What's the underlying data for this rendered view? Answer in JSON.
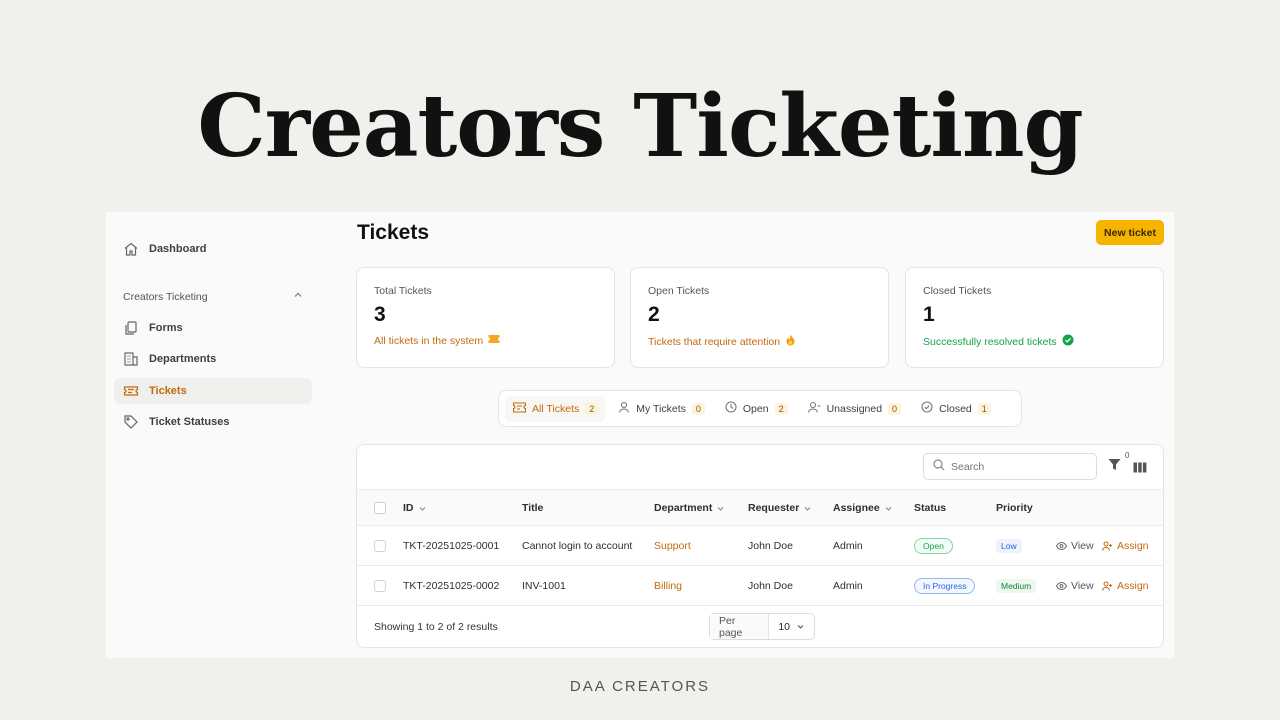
{
  "hero": {
    "title": "Creators Ticketing",
    "footer": "DAA CREATORS"
  },
  "sidebar": {
    "dashboard": "Dashboard",
    "group_label": "Creators Ticketing",
    "items": [
      {
        "label": "Forms",
        "icon": "forms-icon"
      },
      {
        "label": "Departments",
        "icon": "building-icon"
      },
      {
        "label": "Tickets",
        "icon": "ticket-icon",
        "active": true
      },
      {
        "label": "Ticket Statuses",
        "icon": "tag-icon"
      }
    ]
  },
  "header": {
    "title": "Tickets",
    "new_ticket": "New ticket"
  },
  "stats": [
    {
      "label": "Total Tickets",
      "value": "3",
      "desc": "All tickets in the system",
      "color": "#c26a12"
    },
    {
      "label": "Open Tickets",
      "value": "2",
      "desc": "Tickets that require attention",
      "color": "#c26a12"
    },
    {
      "label": "Closed Tickets",
      "value": "1",
      "desc": "Successfully resolved tickets",
      "color": "#16a34a"
    }
  ],
  "tabs": [
    {
      "label": "All Tickets",
      "count": "2",
      "active": true
    },
    {
      "label": "My Tickets",
      "count": "0"
    },
    {
      "label": "Open",
      "count": "2"
    },
    {
      "label": "Unassigned",
      "count": "0"
    },
    {
      "label": "Closed",
      "count": "1"
    }
  ],
  "table": {
    "search_placeholder": "Search",
    "filter_count": "0",
    "columns": [
      "ID",
      "Title",
      "Department",
      "Requester",
      "Assignee",
      "Status",
      "Priority"
    ],
    "rows": [
      {
        "id": "TKT-20251025-0001",
        "title": "Cannot login to account",
        "department": "Support",
        "requester": "John Doe",
        "assignee": "Admin",
        "status": "Open",
        "priority": "Low"
      },
      {
        "id": "TKT-20251025-0002",
        "title": "INV-1001",
        "department": "Billing",
        "requester": "John Doe",
        "assignee": "Admin",
        "status": "In Progress",
        "priority": "Medium"
      }
    ],
    "actions": {
      "view": "View",
      "assign": "Assign"
    },
    "footer": "Showing 1 to 2 of 2 results",
    "per_page_label": "Per page",
    "per_page_value": "10"
  },
  "colors": {
    "accent": "#f5b400",
    "brand_text": "#c26a12",
    "success": "#16a34a",
    "info": "#2563eb"
  }
}
